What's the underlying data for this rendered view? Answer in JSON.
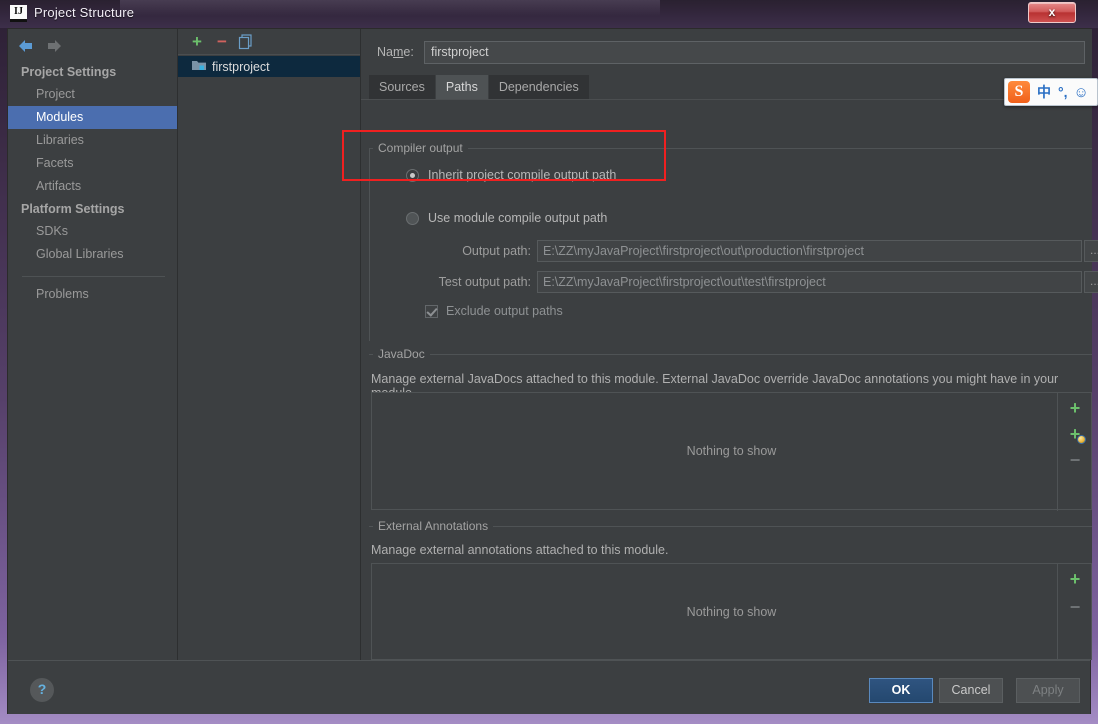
{
  "window": {
    "title": "Project Structure",
    "app_icon": "IJ",
    "close_label": "x"
  },
  "sidebar": {
    "back_icon": "arrow-left-icon",
    "forward_icon": "arrow-right-icon",
    "groups": [
      {
        "label": "Project Settings",
        "items": [
          {
            "label": "Project",
            "selected": false
          },
          {
            "label": "Modules",
            "selected": true
          },
          {
            "label": "Libraries",
            "selected": false
          },
          {
            "label": "Facets",
            "selected": false
          },
          {
            "label": "Artifacts",
            "selected": false
          }
        ]
      },
      {
        "label": "Platform Settings",
        "items": [
          {
            "label": "SDKs",
            "selected": false
          },
          {
            "label": "Global Libraries",
            "selected": false
          }
        ]
      }
    ],
    "problems_label": "Problems"
  },
  "modules": {
    "toolbar": {
      "add_label": "+",
      "remove_label": "−",
      "copy_icon": "copy-icon"
    },
    "selected_module": "firstproject"
  },
  "content": {
    "name_label_pre": "Na",
    "name_label_mnemonic": "m",
    "name_label_post": "e:",
    "name_value": "firstproject",
    "tabs": [
      {
        "label": "Sources",
        "active": false
      },
      {
        "label": "Paths",
        "active": true
      },
      {
        "label": "Dependencies",
        "active": false
      }
    ],
    "compiler_output": {
      "group_title": "Compiler output",
      "inherit_label": "Inherit project compile output path",
      "inherit_selected": true,
      "module_label": "Use module compile output path",
      "module_selected": false,
      "output_path_label": "Output path:",
      "output_path_value": "E:\\ZZ\\myJavaProject\\firstproject\\out\\production\\firstproject",
      "test_output_path_label": "Test output path:",
      "test_output_path_value": "E:\\ZZ\\myJavaProject\\firstproject\\out\\test\\firstproject",
      "browse_label": "...",
      "exclude_label": "Exclude output paths",
      "exclude_checked": true
    },
    "javadoc": {
      "group_title": "JavaDoc",
      "description": "Manage external JavaDocs attached to this module. External JavaDoc override JavaDoc annotations you might have in your module.",
      "empty_text": "Nothing to show",
      "add_label": "+",
      "add_url_label": "+",
      "remove_label": "−"
    },
    "external_annotations": {
      "group_title": "External Annotations",
      "description": "Manage external annotations attached to this module.",
      "empty_text": "Nothing to show",
      "add_label": "+",
      "remove_label": "−"
    }
  },
  "bottom": {
    "help_label": "?",
    "ok_label": "OK",
    "cancel_label": "Cancel",
    "apply_label": "Apply"
  },
  "ime": {
    "logo_label": "S",
    "mode_label": "中",
    "punctuation_label": "°,",
    "smiley_label": "☺"
  },
  "annotation": {
    "color": "#f02020"
  }
}
